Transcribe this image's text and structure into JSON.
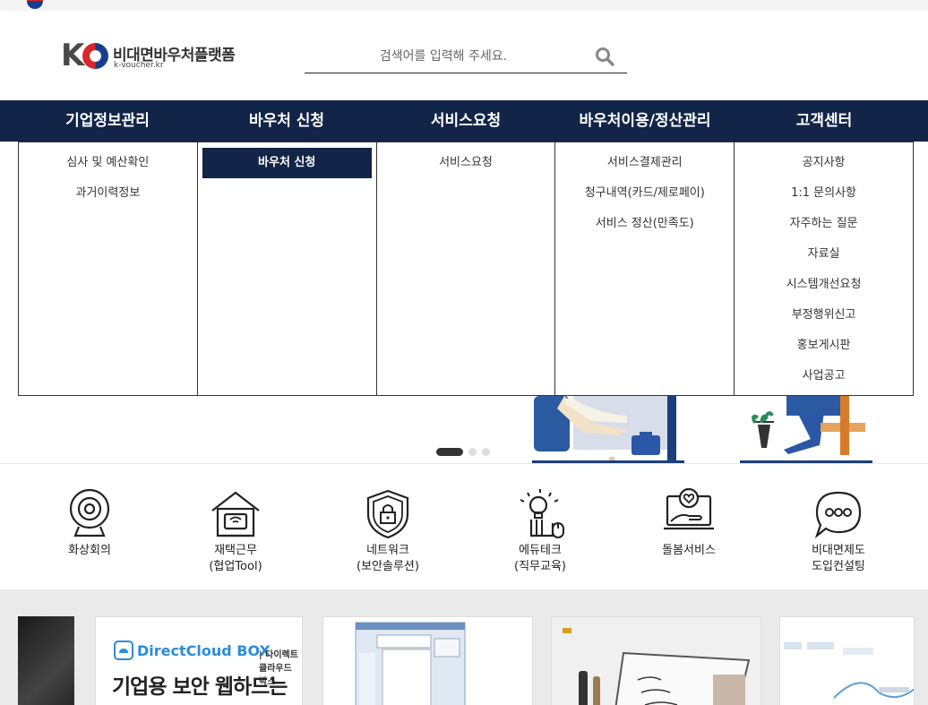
{
  "logo": {
    "title": "비대면바우처플랫폼",
    "domain": "k-voucher.kr",
    "mark_letter": "K"
  },
  "search": {
    "placeholder": "검색어를 입력해 주세요."
  },
  "nav": {
    "menus": [
      "기업정보관리",
      "바우처 신청",
      "서비스요청",
      "바우처이용/정산관리",
      "고객센터"
    ],
    "columns": [
      [
        "심사 및 예산확인",
        "과거이력정보"
      ],
      [
        "바우처 신청"
      ],
      [
        "서비스요청"
      ],
      [
        "서비스결제관리",
        "청구내역(카드/제로페이)",
        "서비스 정산(만족도)"
      ],
      [
        "공지사항",
        "1:1 문의사항",
        "자주하는 질문",
        "자료실",
        "시스템개선요청",
        "부정행위신고",
        "홍보게시판",
        "사업공고"
      ]
    ],
    "active_submenu": "바우처 신청"
  },
  "slider": {
    "dots": 3,
    "active": 0
  },
  "services": [
    {
      "line1": "화상회의",
      "line2": "",
      "icon": "webcam-icon"
    },
    {
      "line1": "재택근무",
      "line2": "(협업Tool)",
      "icon": "home-office-icon"
    },
    {
      "line1": "네트워크",
      "line2": "(보안솔루션)",
      "icon": "security-shield-icon"
    },
    {
      "line1": "에듀테크",
      "line2": "(직무교육)",
      "icon": "edutech-idea-icon"
    },
    {
      "line1": "돌봄서비스",
      "line2": "",
      "icon": "care-laptop-icon"
    },
    {
      "line1": "비대면제도",
      "line2": "도입컨설팅",
      "icon": "chat-consulting-icon"
    }
  ],
  "cards": {
    "card1": {
      "brand": "DirectCloud BOX",
      "brand_sub": "| 다이렉트 클라우드 박스",
      "headline": "기업용 보안 웹하드는"
    }
  },
  "colors": {
    "nav_bg": "#122548",
    "brand_blue": "#2a8cd8"
  }
}
